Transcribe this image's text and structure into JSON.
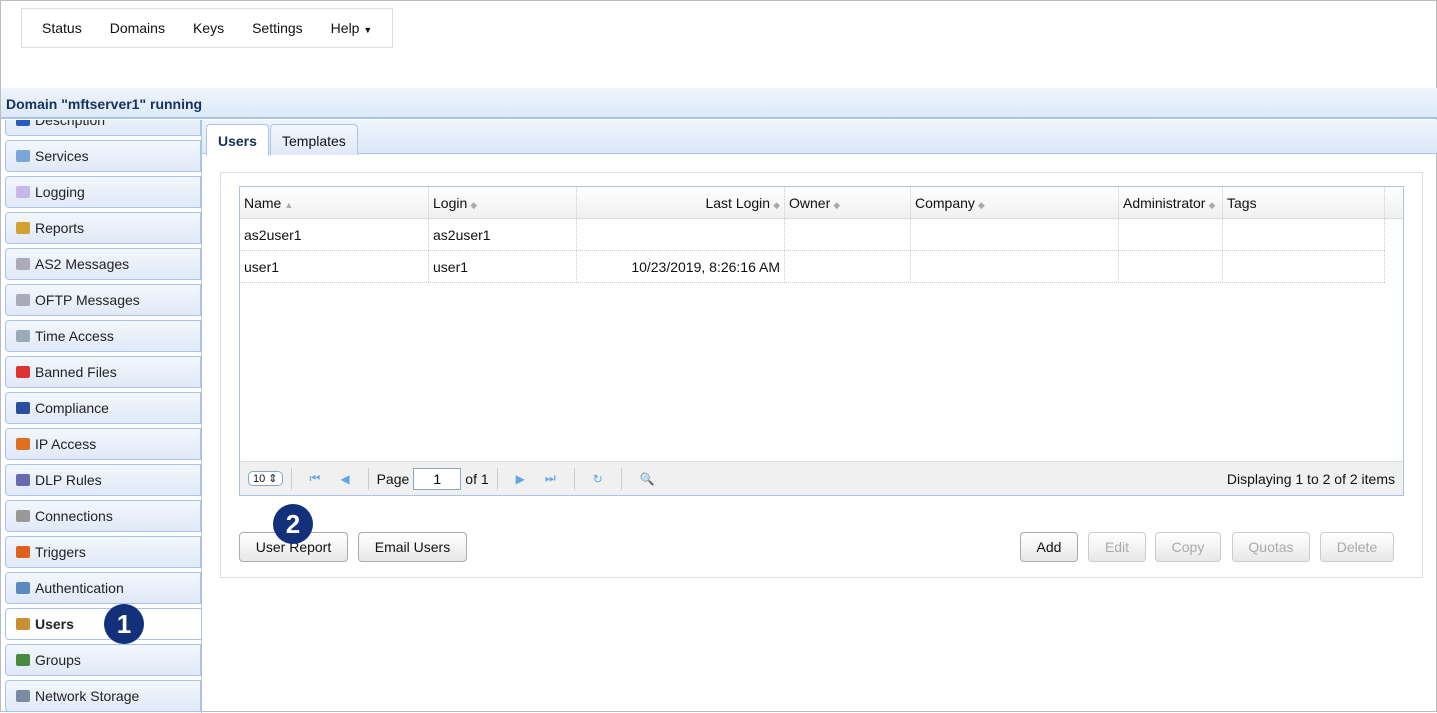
{
  "menu": [
    "Status",
    "Domains",
    "Keys",
    "Settings",
    "Help"
  ],
  "domain_status": "Domain \"mftserver1\" running",
  "sidebar": [
    {
      "label": "Description",
      "color": "#2a5bbf"
    },
    {
      "label": "Services",
      "color": "#7aa6d8"
    },
    {
      "label": "Logging",
      "color": "#c8b8e8"
    },
    {
      "label": "Reports",
      "color": "#d4a030"
    },
    {
      "label": "AS2 Messages",
      "color": "#aab"
    },
    {
      "label": "OFTP Messages",
      "color": "#aab"
    },
    {
      "label": "Time Access",
      "color": "#9ab"
    },
    {
      "label": "Banned Files",
      "color": "#d33"
    },
    {
      "label": "Compliance",
      "color": "#2a4f9f"
    },
    {
      "label": "IP Access",
      "color": "#e07020"
    },
    {
      "label": "DLP Rules",
      "color": "#6a6ab0"
    },
    {
      "label": "Connections",
      "color": "#999"
    },
    {
      "label": "Triggers",
      "color": "#e06020"
    },
    {
      "label": "Authentication",
      "color": "#5a8ac0"
    },
    {
      "label": "Users",
      "color": "#c89030"
    },
    {
      "label": "Groups",
      "color": "#4a8a40"
    },
    {
      "label": "Network Storage",
      "color": "#7a8aa0"
    }
  ],
  "active_sidebar": "Users",
  "tabs": [
    "Users",
    "Templates"
  ],
  "grid": {
    "columns": [
      "Name",
      "Login",
      "Last Login",
      "Owner",
      "Company",
      "Administrator",
      "Tags"
    ],
    "rows": [
      [
        "as2user1",
        "as2user1",
        "",
        "",
        "",
        "",
        ""
      ],
      [
        "user1",
        "user1",
        "10/23/2019, 8:26:16 AM",
        "",
        "",
        "",
        ""
      ]
    ]
  },
  "pager": {
    "page_size": "10",
    "page_label": "Page",
    "page": "1",
    "of": "of 1",
    "display": "Displaying 1 to 2 of 2 items"
  },
  "buttons": {
    "user_report": "User Report",
    "email_users": "Email Users",
    "add": "Add",
    "edit": "Edit",
    "copy": "Copy",
    "quotas": "Quotas",
    "delete": "Delete"
  },
  "badges": [
    "1",
    "2"
  ]
}
